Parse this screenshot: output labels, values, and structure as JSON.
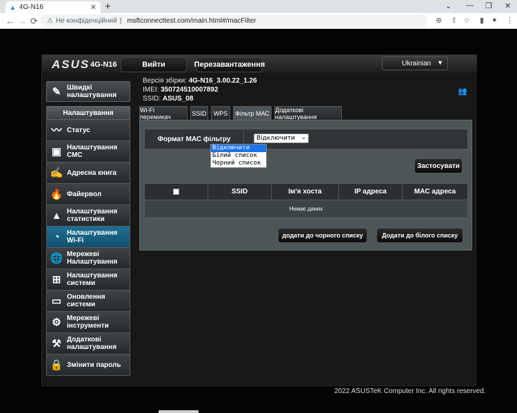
{
  "browser": {
    "tab_title": "4G-N16",
    "tab_close": "✕",
    "new_tab": "+",
    "win_min": "—",
    "win_max": "❐",
    "win_close": "✕",
    "back": "←",
    "forward": "→",
    "reload": "⟳",
    "security_label": "Не конфіденційний",
    "separator": "|",
    "url": "msftconnecttest.com/main.html#/macFilter"
  },
  "header": {
    "logo": "ASUS",
    "model": "4G-N16",
    "logout_label": "Вийти",
    "reboot_label": "Перезавантаження",
    "language": "Ukrainian",
    "firmware_label": "Версія збірки:",
    "firmware_value": "4G-N16_3.00.22_1.26",
    "imei_label": "IMEI:",
    "imei_value": "350724510007892",
    "ssid_label": "SSID:",
    "ssid_value": "ASUS_08"
  },
  "sidebar": {
    "quick_setup": "Швидкі налаштування",
    "section_title": "Налаштування",
    "items": [
      {
        "label": "Статус",
        "icon": "status-icon"
      },
      {
        "label": "Налаштування СМС",
        "icon": "sms-icon"
      },
      {
        "label": "Адресна книга",
        "icon": "address-book-icon"
      },
      {
        "label": "Файервол",
        "icon": "firewall-icon"
      },
      {
        "label": "Налаштування статистики",
        "icon": "statistics-icon"
      },
      {
        "label": "Налаштування Wi-Fi",
        "icon": "wifi-icon",
        "active": true
      },
      {
        "label": "Мережеві Налаштування",
        "icon": "network-icon"
      },
      {
        "label": "Налаштування системи",
        "icon": "system-icon"
      },
      {
        "label": "Оновлення системи",
        "icon": "update-icon"
      },
      {
        "label": "Мережеві інструменти",
        "icon": "tools-icon"
      },
      {
        "label": "Додаткові налаштування",
        "icon": "advanced-icon"
      },
      {
        "label": "Змінити пароль",
        "icon": "lock-icon"
      }
    ]
  },
  "tabs": [
    {
      "label": "Wi-Fi перемикач",
      "active": false
    },
    {
      "label": "SSID",
      "active": false
    },
    {
      "label": "WPS",
      "active": false
    },
    {
      "label": "Фільтр МАС",
      "active": true
    },
    {
      "label": "Додаткові налаштування",
      "active": false
    }
  ],
  "mac_filter": {
    "format_label": "Формат МАС фільтру",
    "selected": "Відключити",
    "options": [
      "Відключити",
      "Білий список",
      "Чорний список"
    ],
    "apply_label": "Застосувати",
    "columns": [
      "",
      "SSID",
      "Ім'я хоста",
      "IP адреса",
      "MAC адреса"
    ],
    "empty_text": "Немає даних",
    "add_black_label": "додати до чорного списку",
    "add_white_label": "Додати до білого списку"
  },
  "footer": {
    "copyright": "2022 ASUSTeK Computer Inc. All rights reserved."
  }
}
